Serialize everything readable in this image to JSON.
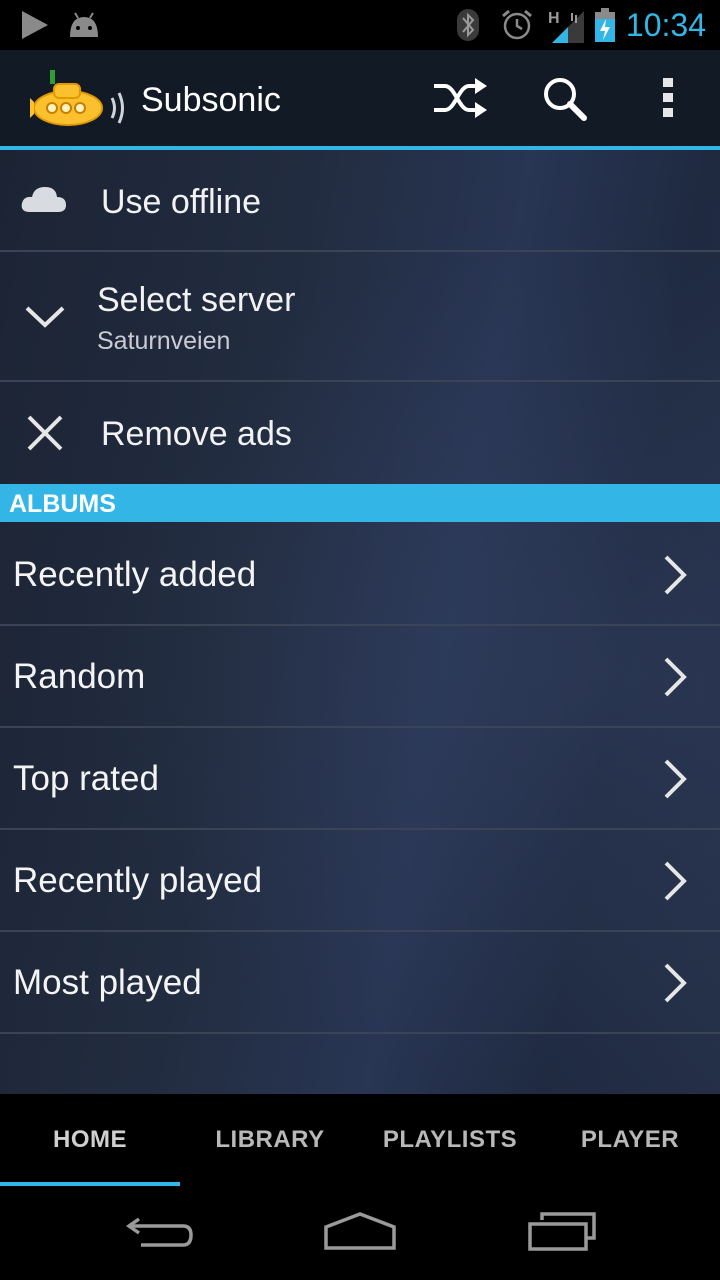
{
  "status_bar": {
    "time": "10:34",
    "icons": [
      "play-icon",
      "android-icon",
      "bluetooth-icon",
      "alarm-icon",
      "signal-icon",
      "battery-charging-icon"
    ],
    "network_label": "H"
  },
  "action_bar": {
    "app_title": "Subsonic",
    "actions": [
      "shuffle-icon",
      "search-icon",
      "overflow-menu-icon"
    ]
  },
  "menu": {
    "use_offline": "Use offline",
    "select_server": "Select server",
    "server_name": "Saturnveien",
    "remove_ads": "Remove ads"
  },
  "albums": {
    "header": "ALBUMS",
    "items": [
      {
        "label": "Recently added"
      },
      {
        "label": "Random"
      },
      {
        "label": "Top rated"
      },
      {
        "label": "Recently played"
      },
      {
        "label": "Most played"
      }
    ]
  },
  "tabs": [
    {
      "label": "HOME",
      "active": true
    },
    {
      "label": "LIBRARY",
      "active": false
    },
    {
      "label": "PLAYLISTS",
      "active": false
    },
    {
      "label": "PLAYER",
      "active": false
    }
  ],
  "colors": {
    "accent": "#33b5e5",
    "action_bar": "#121a26",
    "logo_yellow": "#fbc02d"
  }
}
